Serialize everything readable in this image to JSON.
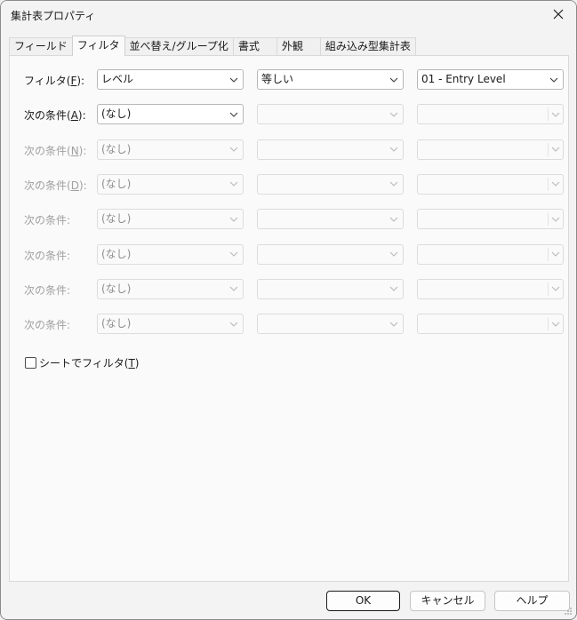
{
  "window": {
    "title": "集計表プロパティ"
  },
  "tabs": [
    {
      "label": "フィールド"
    },
    {
      "label": "フィルタ"
    },
    {
      "label": "並べ替え/グループ化"
    },
    {
      "label": "書式"
    },
    {
      "label": "外観"
    },
    {
      "label": "組み込み型集計表"
    }
  ],
  "rows": [
    {
      "label_pre": "フィルタ(",
      "label_key": "F",
      "label_post": "):",
      "field": "レベル",
      "operator": "等しい",
      "value": "01 - Entry Level"
    },
    {
      "label_pre": "次の条件(",
      "label_key": "A",
      "label_post": "):",
      "field": "(なし)",
      "operator": "",
      "value": ""
    },
    {
      "label_pre": "次の条件(",
      "label_key": "N",
      "label_post": "):",
      "field": "(なし)",
      "operator": "",
      "value": ""
    },
    {
      "label_pre": "次の条件(",
      "label_key": "D",
      "label_post": "):",
      "field": "(なし)",
      "operator": "",
      "value": ""
    },
    {
      "label_pre": "次の条件:",
      "label_key": "",
      "label_post": "",
      "field": "(なし)",
      "operator": "",
      "value": ""
    },
    {
      "label_pre": "次の条件:",
      "label_key": "",
      "label_post": "",
      "field": "(なし)",
      "operator": "",
      "value": ""
    },
    {
      "label_pre": "次の条件:",
      "label_key": "",
      "label_post": "",
      "field": "(なし)",
      "operator": "",
      "value": ""
    },
    {
      "label_pre": "次の条件:",
      "label_key": "",
      "label_post": "",
      "field": "(なし)",
      "operator": "",
      "value": ""
    }
  ],
  "checkbox": {
    "label_pre": "シートでフィルタ(",
    "label_key": "T",
    "label_post": ")",
    "checked": false
  },
  "buttons": {
    "ok": "OK",
    "cancel": "キャンセル",
    "help": "ヘルプ"
  }
}
